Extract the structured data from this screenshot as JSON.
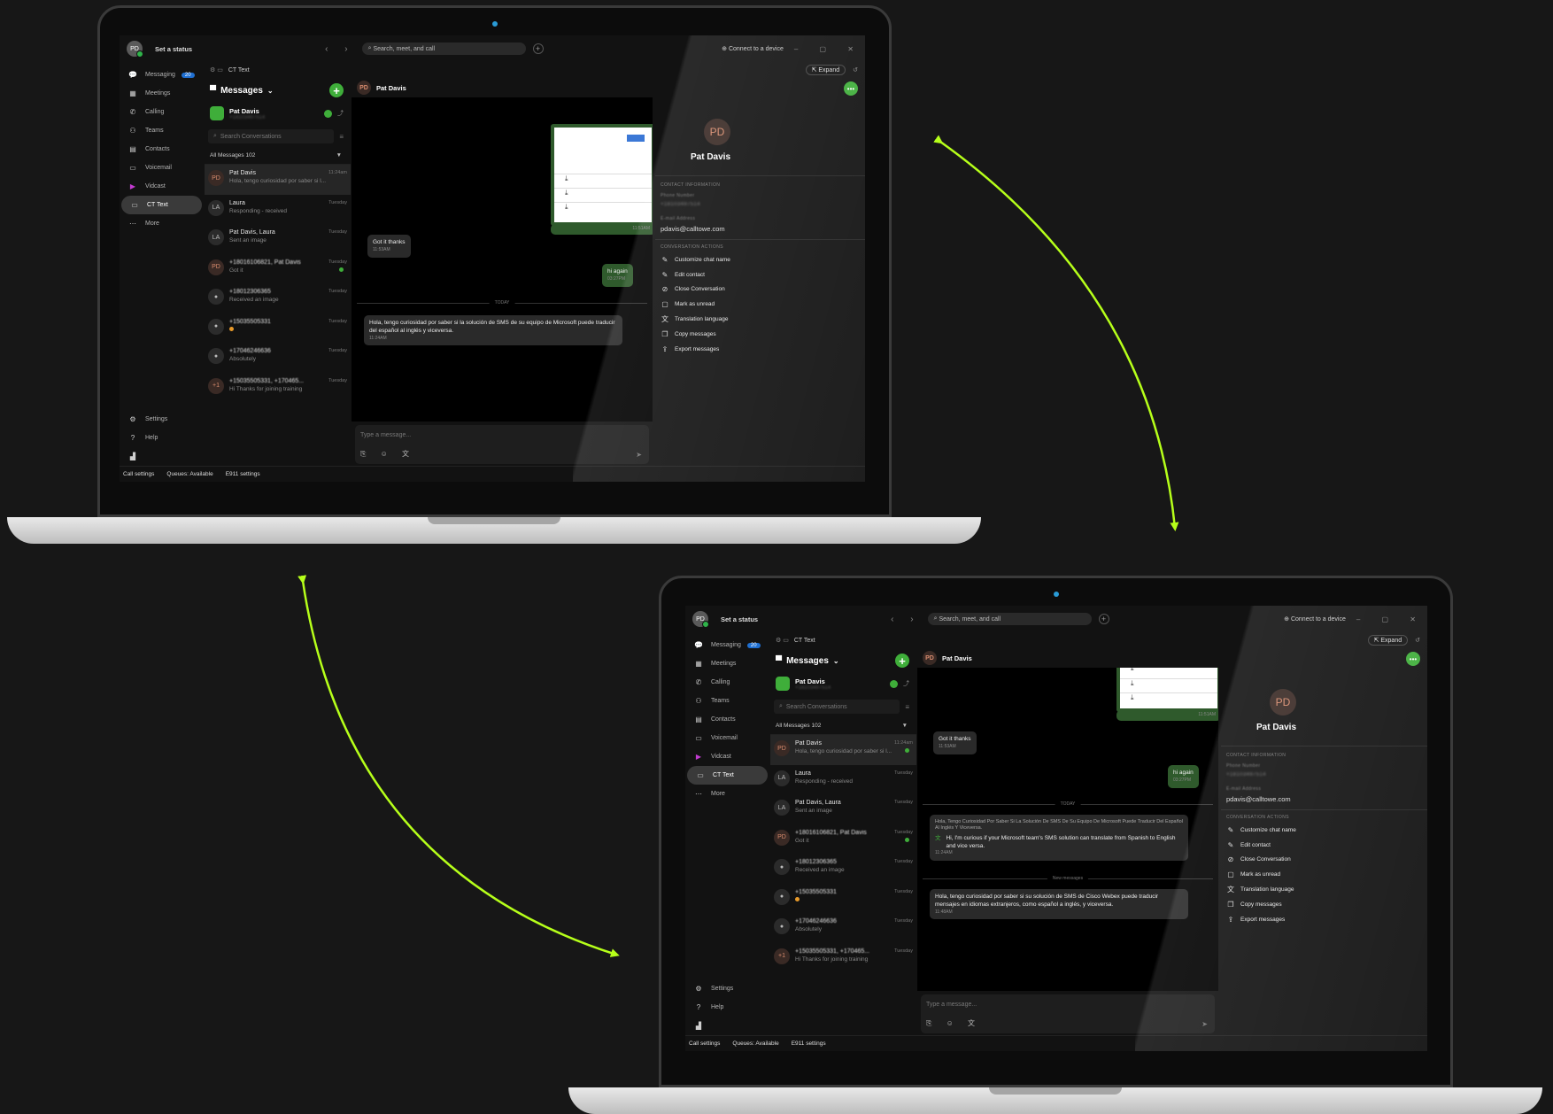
{
  "app": {
    "set_status": "Set a status",
    "user_initials": "PD",
    "search_placeholder": "Search, meet, and call",
    "connect": "⊕ Connect to a device",
    "breadcrumb": "CT Text",
    "expand": "⇱ Expand"
  },
  "nav": {
    "items": [
      {
        "icon": "💬",
        "label": "Messaging",
        "badge": "20"
      },
      {
        "icon": "▦",
        "label": "Meetings"
      },
      {
        "icon": "✆",
        "label": "Calling"
      },
      {
        "icon": "⚇",
        "label": "Teams"
      },
      {
        "icon": "▤",
        "label": "Contacts"
      },
      {
        "icon": "▭",
        "label": "Voicemail"
      },
      {
        "icon": "▶",
        "label": "Vidcast"
      },
      {
        "icon": "▭",
        "label": "CT Text"
      },
      {
        "icon": "⋯",
        "label": "More"
      }
    ],
    "settings": "Settings",
    "help": "Help"
  },
  "statusbar": {
    "call_settings": "Call settings",
    "queues": "Queues: Available",
    "e911": "E911 settings"
  },
  "messages": {
    "title": "Messages",
    "me": "Pat Davis",
    "search_placeholder": "Search Conversations",
    "filter": "All Messages 102"
  },
  "conversations": [
    {
      "initials": "PD",
      "name": "Pat Davis",
      "time": "11:24am",
      "preview": "Hola, tengo curiosidad por saber si l..."
    },
    {
      "initials": "LA",
      "name": "Laura",
      "time": "Tuesday",
      "preview": "Responding - received"
    },
    {
      "initials": "LA",
      "name": "Pat Davis, Laura",
      "time": "Tuesday",
      "preview": "Sent an image"
    },
    {
      "initials": "PD",
      "name": "+18016106821, Pat Davis",
      "time": "Tuesday",
      "preview": "Got it"
    },
    {
      "initials": "",
      "name": "+18012306365",
      "time": "Tuesday",
      "preview": "Received an image"
    },
    {
      "initials": "",
      "name": "+15035505331",
      "time": "Tuesday",
      "preview": ""
    },
    {
      "initials": "",
      "name": "+17046246636",
      "time": "Tuesday",
      "preview": "Absolutely"
    },
    {
      "initials": "+1",
      "name": "+15035505331, +170465...",
      "time": "Tuesday",
      "preview": "Hi Thanks for joining training"
    }
  ],
  "chat": {
    "contact": "Pat Davis",
    "msg_got_it": "Got it thanks",
    "msg_got_it_time": "11:53AM",
    "msg_hi_again": "hi again",
    "msg_hi_again_time": "03:27PM",
    "img_time": "11:51AM",
    "divider_today": "TODAY",
    "divider_new": "New messages",
    "msg_spanish_top": "Hola, tengo curiosidad por saber si la solución de SMS de su equipo de Microsoft puede traducir del español al inglés y viceversa.",
    "msg_spanish_top_time": "11:24AM",
    "msg_translated_orig": "Hola, Tengo Curiosidad Por Saber Si La Solución De SMS De Su Equipo De Microsoft Puede Traducir Del Español Al Inglés Y Viceversa.",
    "msg_translated": "Hi, I'm curious if your Microsoft team's SMS solution can translate from Spanish to English and vice versa.",
    "msg_translated_time": "11:24AM",
    "msg_spanish_bottom": "Hola, tengo curiosidad por saber si su solución de SMS de Cisco Webex puede traducir mensajes en idiomas extranjeros, como español a inglés, y viceversa.",
    "msg_spanish_bottom_time": "11:48AM",
    "composer_placeholder": "Type a message..."
  },
  "details": {
    "initials": "PD",
    "name": "Pat Davis",
    "contact_info": "CONTACT INFORMATION",
    "phone_label": "Phone Number",
    "phone": "+18103497514",
    "email_label": "E-mail Address",
    "email": "pdavis@calltowe.com",
    "conversation_actions": "CONVERSATION ACTIONS",
    "actions": [
      {
        "icon": "✎",
        "label": "Customize chat name"
      },
      {
        "icon": "✎",
        "label": "Edit contact"
      },
      {
        "icon": "⊘",
        "label": "Close Conversation"
      },
      {
        "icon": "▢",
        "label": "Mark as unread"
      },
      {
        "icon": "文",
        "label": "Translation language"
      },
      {
        "icon": "❐",
        "label": "Copy messages"
      },
      {
        "icon": "⇪",
        "label": "Export messages"
      }
    ]
  },
  "colors": {
    "accent_green": "#3fae3a",
    "arrow": "#b6ff1a",
    "background": "#171717"
  }
}
